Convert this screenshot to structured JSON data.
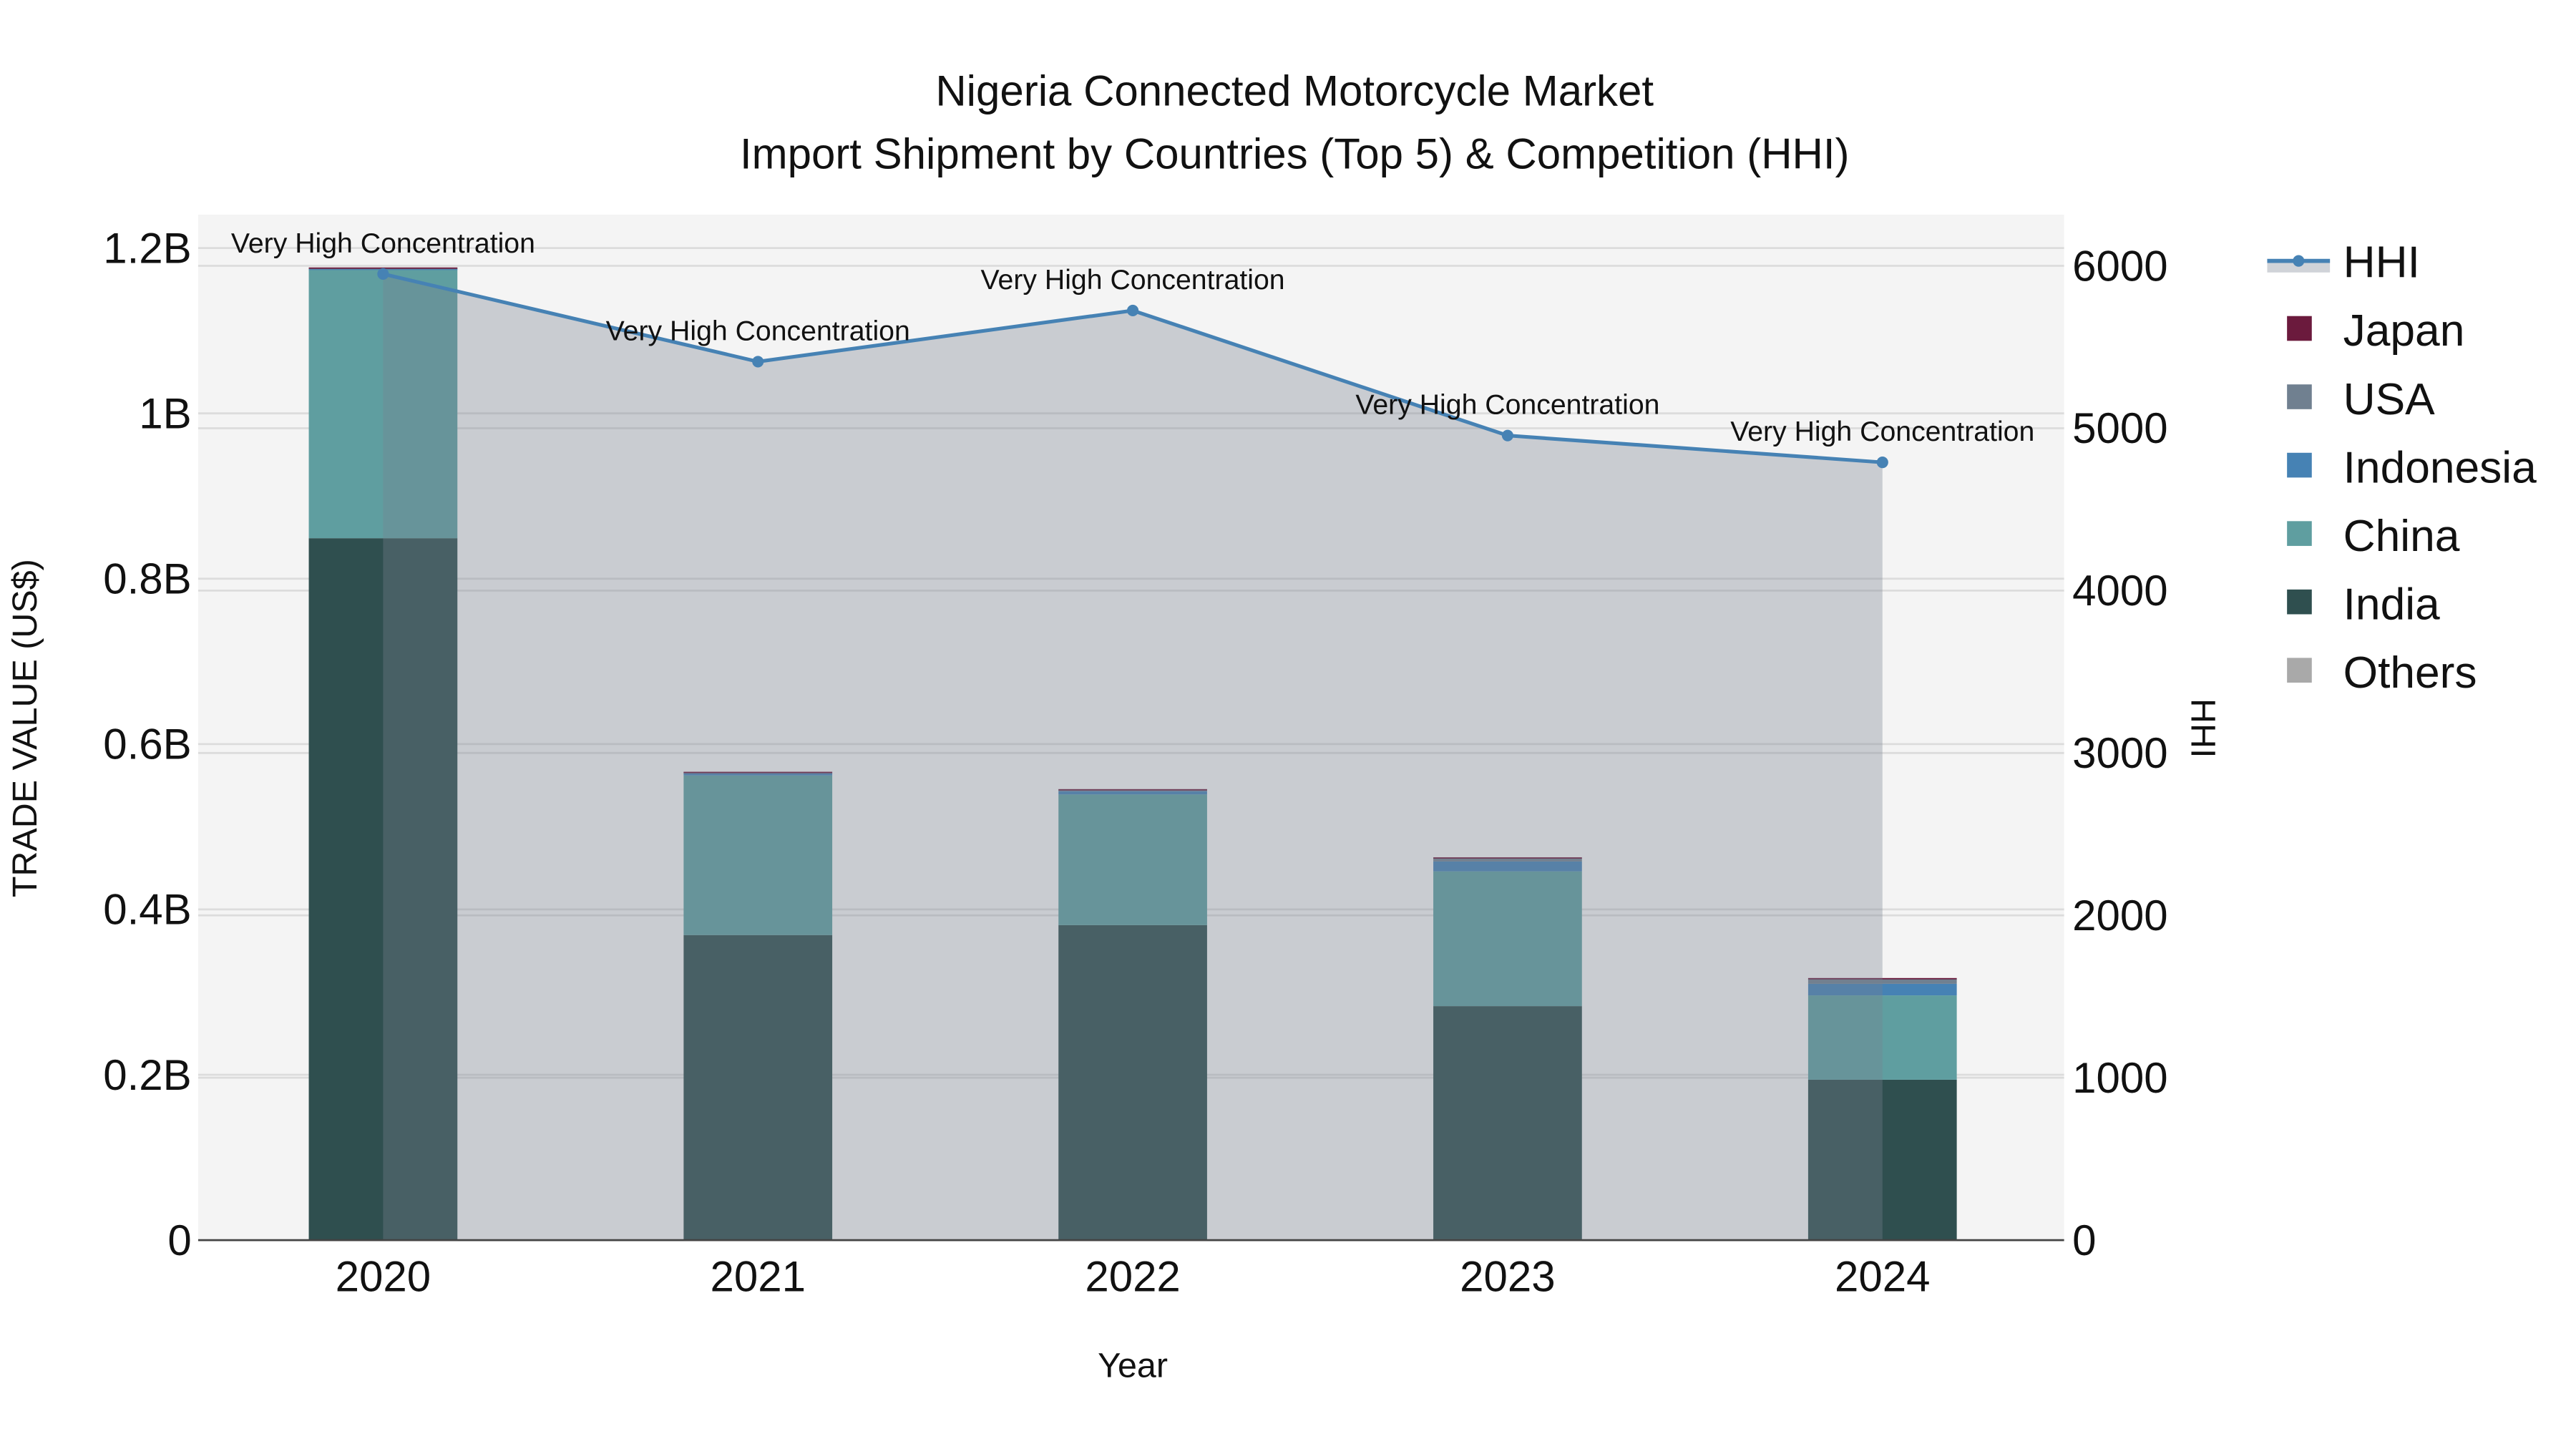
{
  "chart_data": {
    "type": "bar",
    "title": "Nigeria Connected Motorcycle Market",
    "subtitle": "Import Shipment by Countries (Top 5) & Competition (HHI)",
    "xlabel": "Year",
    "ylabel": "TRADE VALUE (US$)",
    "y2label": "HHI",
    "categories": [
      "2020",
      "2021",
      "2022",
      "2023",
      "2024"
    ],
    "ylim": [
      0,
      1.2
    ],
    "y_ticks": [
      0,
      0.2,
      0.4,
      0.6,
      0.8,
      1,
      1.2
    ],
    "y_tick_labels": [
      "0",
      "0.2B",
      "0.4B",
      "0.6B",
      "0.8B",
      "1B",
      "1.2B"
    ],
    "y2lim": [
      0,
      6000
    ],
    "y2_ticks": [
      0,
      1000,
      2000,
      3000,
      4000,
      5000,
      6000
    ],
    "y2_tick_labels": [
      "0",
      "1000",
      "2000",
      "3000",
      "4000",
      "5000",
      "6000"
    ],
    "units": "billion US$",
    "series": [
      {
        "name": "Others",
        "color": "#A9A9A9",
        "values": [
          0.0,
          0.0,
          0.0,
          0.001,
          0.0
        ]
      },
      {
        "name": "India",
        "color": "#2F4F4F",
        "values": [
          0.849,
          0.369,
          0.381,
          0.282,
          0.194
        ]
      },
      {
        "name": "China",
        "color": "#5F9EA0",
        "values": [
          0.325,
          0.193,
          0.158,
          0.163,
          0.102
        ]
      },
      {
        "name": "Indonesia",
        "color": "#4682B4",
        "values": [
          0.001,
          0.003,
          0.004,
          0.012,
          0.014
        ]
      },
      {
        "name": "USA",
        "color": "#708090",
        "values": [
          0.001,
          0.001,
          0.002,
          0.004,
          0.006
        ]
      },
      {
        "name": "Japan",
        "color": "#6B1A3D",
        "values": [
          0.0005,
          0.0005,
          0.0005,
          0.001,
          0.001
        ]
      }
    ],
    "hhi": {
      "name": "HHI",
      "color": "#4682B4",
      "values": [
        5950,
        5410,
        5725,
        4955,
        4790
      ],
      "annotations": [
        "Very High Concentration",
        "Very High Concentration",
        "Very High Concentration",
        "Very High Concentration",
        "Very High Concentration"
      ]
    },
    "legend": [
      "HHI",
      "Japan",
      "USA",
      "Indonesia",
      "China",
      "India",
      "Others"
    ],
    "legend_position": "right",
    "grid": true
  }
}
